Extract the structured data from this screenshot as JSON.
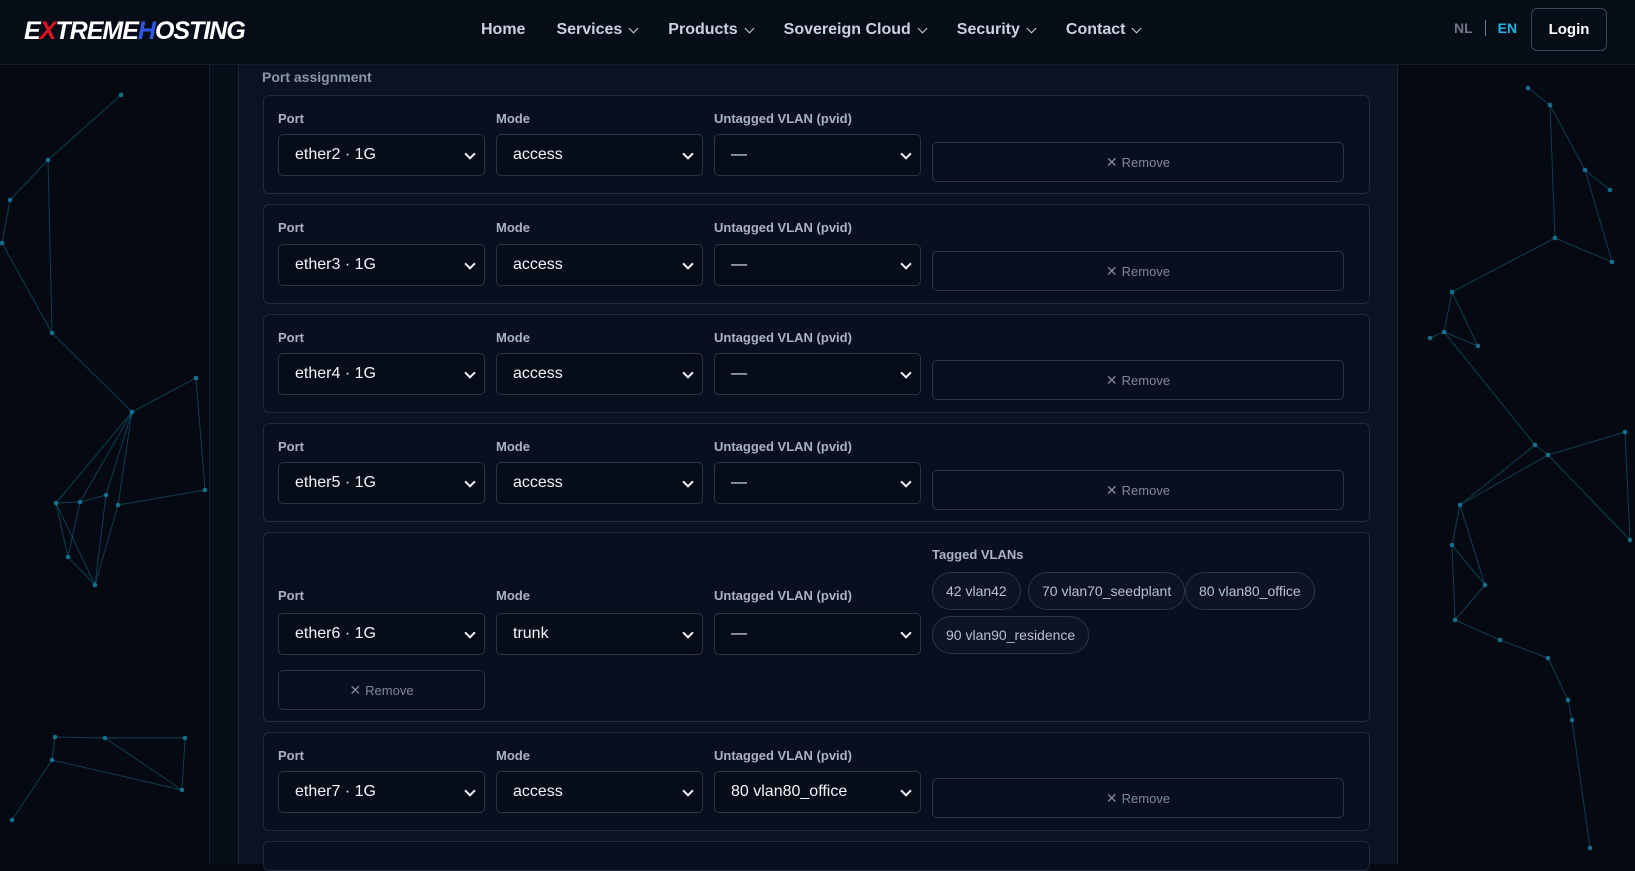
{
  "brand": {
    "logo_prefix_a": "E",
    "logo_red": "X",
    "logo_mid": "TREME",
    "logo_blue": "H",
    "logo_suffix": "OSTING"
  },
  "nav": {
    "home": "Home",
    "services": "Services",
    "products": "Products",
    "sovereign_cloud": "Sovereign Cloud",
    "security": "Security",
    "contact": "Contact"
  },
  "lang": {
    "nl": "NL",
    "en": "EN"
  },
  "login_label": "Login",
  "section_title": "Port assignment",
  "labels": {
    "port": "Port",
    "mode": "Mode",
    "untagged": "Untagged VLAN (pvid)",
    "tagged": "Tagged VLANs",
    "remove": "Remove"
  },
  "ports": [
    {
      "port": "ether2 · 1G",
      "mode": "access",
      "pvid": "—"
    },
    {
      "port": "ether3 · 1G",
      "mode": "access",
      "pvid": "—"
    },
    {
      "port": "ether4 · 1G",
      "mode": "access",
      "pvid": "—"
    },
    {
      "port": "ether5 · 1G",
      "mode": "access",
      "pvid": "—"
    },
    {
      "port": "ether6 · 1G",
      "mode": "trunk",
      "pvid": "—",
      "tagged": [
        "42 vlan42",
        "70 vlan70_seedplant",
        "80 vlan80_office",
        "90 vlan90_residence"
      ]
    },
    {
      "port": "ether7 · 1G",
      "mode": "access",
      "pvid": "80 vlan80_office"
    }
  ],
  "colors": {
    "accent": "#1eb4e6",
    "background": "#050a12",
    "card": "#081020",
    "network_lines": "#1a7d9e"
  }
}
